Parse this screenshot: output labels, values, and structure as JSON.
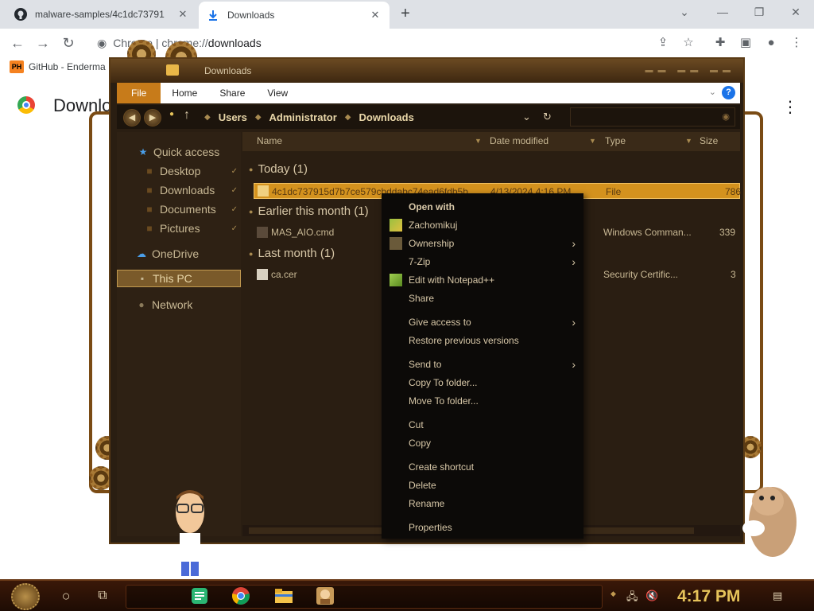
{
  "browser": {
    "tabs": [
      {
        "label": "malware-samples/4c1dc73791",
        "icon": "github-icon",
        "active": false
      },
      {
        "label": "Downloads",
        "icon": "download-icon",
        "active": true
      }
    ],
    "omnibox": {
      "scheme": "Chrome  |  chrome://",
      "host": "downloads"
    },
    "bookmark": {
      "badge": "PH",
      "label": "GitHub - Enderma"
    }
  },
  "downloads_page": {
    "title": "Downloads"
  },
  "explorer": {
    "title": "Downloads",
    "ribbon_tabs": [
      "File",
      "Home",
      "Share",
      "View"
    ],
    "breadcrumb": [
      "Users",
      "Administrator",
      "Downloads"
    ],
    "nav": {
      "quick_access": "Quick access",
      "desktop": "Desktop",
      "downloads": "Downloads",
      "documents": "Documents",
      "pictures": "Pictures",
      "onedrive": "OneDrive",
      "this_pc": "This PC",
      "network": "Network"
    },
    "columns": {
      "name": "Name",
      "date": "Date modified",
      "type": "Type",
      "size": "Size"
    },
    "groups": {
      "today": "Today (1)",
      "earlier": "Earlier this month (1)",
      "last_month": "Last month (1)"
    },
    "files": {
      "f1": {
        "name": "4c1dc737915d7b7ce579cbddabc74ead6fdb5b...",
        "date": "4/13/2024 4:16 PM",
        "type": "File",
        "size": "786"
      },
      "f2": {
        "name": "MAS_AIO.cmd",
        "type": "Windows Comman...",
        "size": "339"
      },
      "f3": {
        "name": "ca.cer",
        "type": "Security Certific...",
        "size": "3"
      }
    }
  },
  "context_menu": {
    "open_with": "Open with",
    "zachomikuj": "Zachomikuj",
    "ownership": "Ownership",
    "zip": "7-Zip",
    "notepad": "Edit with Notepad++",
    "share": "Share",
    "give_access": "Give access to",
    "restore": "Restore previous versions",
    "send_to": "Send to",
    "copy_to": "Copy To folder...",
    "move_to": "Move To folder...",
    "cut": "Cut",
    "copy": "Copy",
    "create_shortcut": "Create shortcut",
    "delete": "Delete",
    "rename": "Rename",
    "properties": "Properties"
  },
  "taskbar": {
    "clock": "4:17 PM"
  },
  "colors": {
    "accent_file_tab": "#c77b1a",
    "selection": "#d4921e",
    "clock": "#e6c35a",
    "help": "#1a73e8"
  }
}
